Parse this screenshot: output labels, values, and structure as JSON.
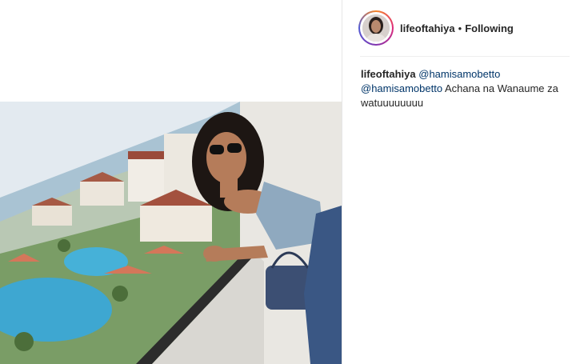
{
  "post": {
    "image_alt": "Photo of a woman in sunglasses leaning on a balcony railing overlooking a resort pool"
  },
  "header": {
    "username": "lifeoftahiya",
    "separator": "•",
    "follow_state": "Following"
  },
  "caption": {
    "username": "lifeoftahiya",
    "mention_1": "@hamisamobetto",
    "mention_2": "@hamisamobetto",
    "text": "Achana na Wanaume za watuuuuuuuu"
  },
  "icons": {
    "avatar": "profile-photo"
  }
}
